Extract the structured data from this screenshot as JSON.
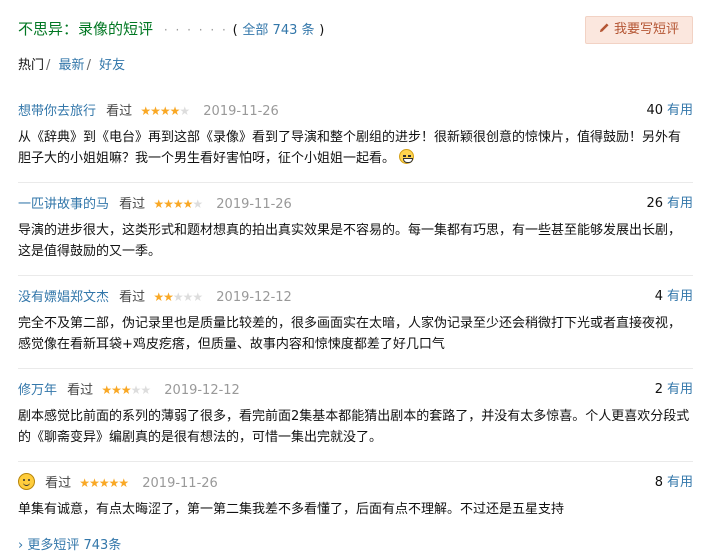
{
  "header": {
    "prefix": "不思异：",
    "title": "录像的短评",
    "dots": "· · · · · ·",
    "paren_open": "(",
    "total": "全部 743 条",
    "paren_close": ")",
    "write_label": "我要写短评"
  },
  "tabs": [
    {
      "label": "热门",
      "sep": "/"
    },
    {
      "label": "最新",
      "sep": "/"
    },
    {
      "label": "好友",
      "sep": ""
    }
  ],
  "comments": [
    {
      "author": "想带你去旅行",
      "watched": "看过",
      "rating": 4,
      "date": "2019-11-26",
      "votes": "40",
      "votes_unit": "有用",
      "content": "从《辞典》到《电台》再到这部《录像》看到了导演和整个剧组的进步！很新颖很创意的惊悚片，值得鼓励！另外有胆子大的小姐姐嘛？我一个男生看好害怕呀，征个小姐姐一起看。"
    },
    {
      "author": "一匹讲故事的马",
      "watched": "看过",
      "rating": 4,
      "date": "2019-11-26",
      "votes": "26",
      "votes_unit": "有用",
      "content": "导演的进步很大，这类形式和题材想真的拍出真实效果是不容易的。每一集都有巧思，有一些甚至能够发展出长剧，这是值得鼓励的又一季。"
    },
    {
      "author": "没有嫖娼郑文杰",
      "watched": "看过",
      "rating": 2,
      "date": "2019-12-12",
      "votes": "4",
      "votes_unit": "有用",
      "content": "完全不及第二部，伪记录里也是质量比较差的，很多画面实在太暗，人家伪记录至少还会稍微打下光或者直接夜视，感觉像在看新耳袋+鸡皮疙瘩，但质量、故事内容和惊悚度都差了好几口气"
    },
    {
      "author": "修万年",
      "watched": "看过",
      "rating": 3,
      "date": "2019-12-12",
      "votes": "2",
      "votes_unit": "有用",
      "content": "剧本感觉比前面的系列的薄弱了很多，看完前面2集基本都能猜出剧本的套路了，并没有太多惊喜。个人更喜欢分段式的《聊斋变异》编剧真的是很有想法的，可惜一集出完就没了。"
    },
    {
      "author": "",
      "watched": "看过",
      "rating": 5,
      "date": "2019-11-26",
      "votes": "8",
      "votes_unit": "有用",
      "content": "单集有诚意，有点太晦涩了，第一第二集我差不多看懂了，后面有点不理解。不过还是五星支持"
    }
  ],
  "more": {
    "arrow": "›",
    "label": "更多短评 743条"
  },
  "colors": {
    "title_green": "#007722",
    "link_blue": "#3377aa",
    "star_gold": "#f9a825",
    "button_bg": "#fbe7de",
    "button_text": "#b45533"
  },
  "icons": {
    "write_button": "pencil-icon",
    "comment1_inline": "grinning-emoji-icon",
    "comment5_avatar": "smiley-avatar-icon"
  }
}
